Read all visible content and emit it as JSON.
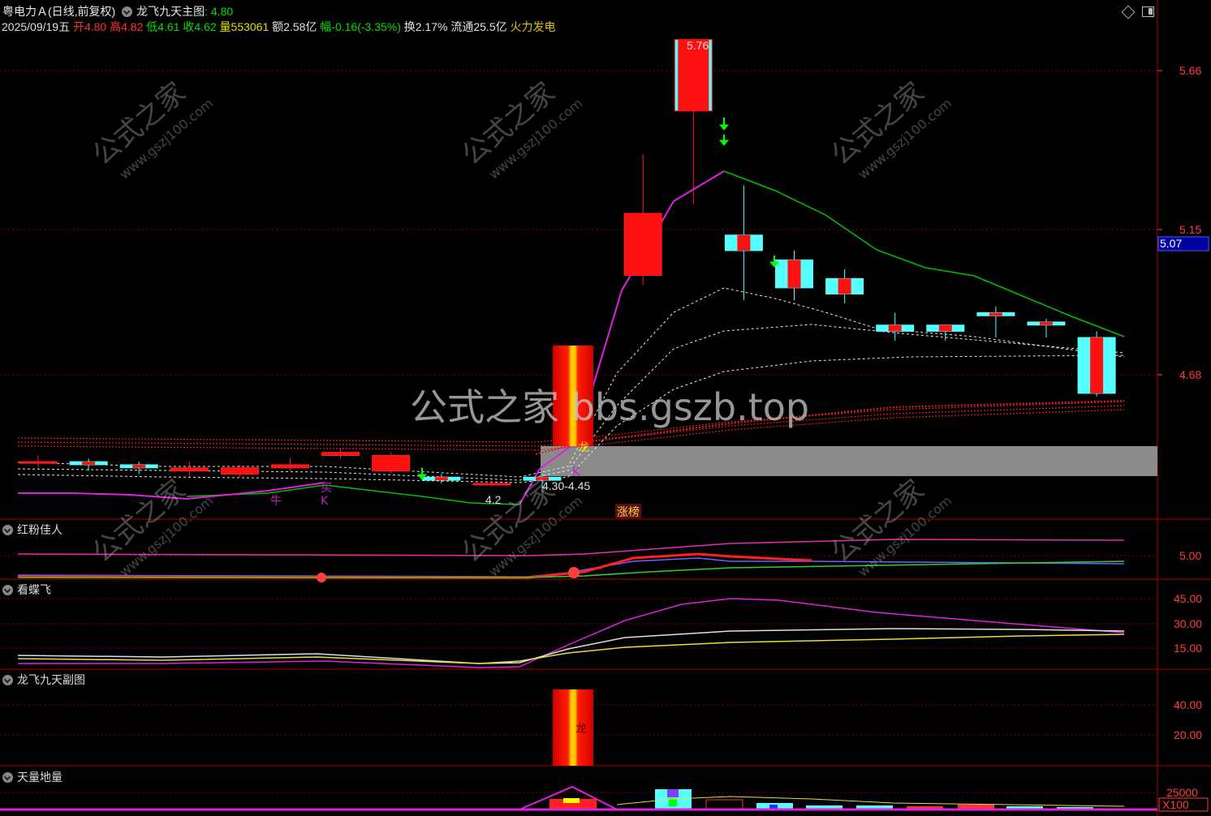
{
  "header": {
    "stock_name": "粤电力Ａ",
    "period_mode": "(日线,前复权)",
    "indicator_name": "龙飞九天主图",
    "indicator_value": ": 4.80",
    "date": "2025/09/19",
    "weekday": "五",
    "open_label": "开",
    "open": "4.80",
    "high_label": "高",
    "high": "4.82",
    "low_label": "低",
    "low": "4.61",
    "close_label": "收",
    "close": "4.62",
    "volume_label": "量",
    "volume": "553061",
    "amount_label": "额",
    "amount": "2.58亿",
    "change_label": "幅",
    "change": "-0.16(-3.35%)",
    "turnover_label": "换",
    "turnover": "2.17%",
    "float_label": "流通",
    "float_cap": "25.5亿",
    "sector": "火力发电"
  },
  "toolbar": {
    "diamond_icon": "diamond-icon",
    "window_icon": "window-icon"
  },
  "price_axis": {
    "ticks": [
      "5.66",
      "5.15",
      "4.68"
    ],
    "current_price": "5.07"
  },
  "annotations": {
    "high_mark": "5.76",
    "low_mark": "4.2",
    "range_mark": "4.30-4.45",
    "limit_up": "涨榜",
    "dragon": "龙",
    "k1": "K",
    "k2": "K",
    "buy1": "牛",
    "buy2": "买"
  },
  "watermark": {
    "center": "公式之家 bbs.gszb.top",
    "diag_main": "公式之家",
    "diag_sub": "www.gszj100.com"
  },
  "panels": [
    {
      "title": "红粉佳人",
      "ticks": [
        "5.00"
      ]
    },
    {
      "title": "看蝶飞",
      "ticks": [
        "45.00",
        "30.00",
        "15.00"
      ]
    },
    {
      "title": "龙飞九天副图",
      "ticks": [
        "40.00",
        "20.00"
      ],
      "label": "龙"
    },
    {
      "title": "天量地量",
      "ticks": [
        "25000"
      ],
      "unit": "X100"
    }
  ],
  "colors": {
    "up": "#ff0000",
    "down": "#55ffff",
    "grid": "#8b0000",
    "ma": "#00c000"
  },
  "chart_data": {
    "type": "candlestick",
    "ylim": [
      4.2,
      5.85
    ],
    "candles": [
      {
        "o": 4.4,
        "h": 4.42,
        "l": 4.38,
        "c": 4.4
      },
      {
        "o": 4.4,
        "h": 4.41,
        "l": 4.37,
        "c": 4.39
      },
      {
        "o": 4.39,
        "h": 4.4,
        "l": 4.36,
        "c": 4.38
      },
      {
        "o": 4.37,
        "h": 4.4,
        "l": 4.35,
        "c": 4.38
      },
      {
        "o": 4.36,
        "h": 4.39,
        "l": 4.35,
        "c": 4.38
      },
      {
        "o": 4.38,
        "h": 4.41,
        "l": 4.37,
        "c": 4.39
      },
      {
        "o": 4.42,
        "h": 4.44,
        "l": 4.41,
        "c": 4.43
      },
      {
        "o": 4.37,
        "h": 4.43,
        "l": 4.36,
        "c": 4.42
      },
      {
        "o": 4.35,
        "h": 4.36,
        "l": 4.33,
        "c": 4.34
      },
      {
        "o": 4.33,
        "h": 4.34,
        "l": 4.32,
        "c": 4.33
      },
      {
        "o": 4.35,
        "h": 4.36,
        "l": 4.3,
        "c": 4.34
      },
      {
        "o": 4.45,
        "h": 4.9,
        "l": 4.45,
        "c": 4.9
      },
      {
        "o": 5.0,
        "h": 5.39,
        "l": 4.97,
        "c": 5.2
      },
      {
        "o": 5.53,
        "h": 5.76,
        "l": 5.23,
        "c": 5.76
      },
      {
        "o": 5.13,
        "h": 5.29,
        "l": 4.92,
        "c": 5.08
      },
      {
        "o": 5.05,
        "h": 5.08,
        "l": 4.92,
        "c": 4.96
      },
      {
        "o": 4.99,
        "h": 5.02,
        "l": 4.91,
        "c": 4.94
      },
      {
        "o": 4.84,
        "h": 4.88,
        "l": 4.79,
        "c": 4.82
      },
      {
        "o": 4.84,
        "h": 4.84,
        "l": 4.79,
        "c": 4.82
      },
      {
        "o": 4.88,
        "h": 4.9,
        "l": 4.8,
        "c": 4.87
      },
      {
        "o": 4.85,
        "h": 4.86,
        "l": 4.8,
        "c": 4.84
      },
      {
        "o": 4.8,
        "h": 4.82,
        "l": 4.61,
        "c": 4.62
      }
    ],
    "volume_note": "shown in 天量地量 panel"
  }
}
